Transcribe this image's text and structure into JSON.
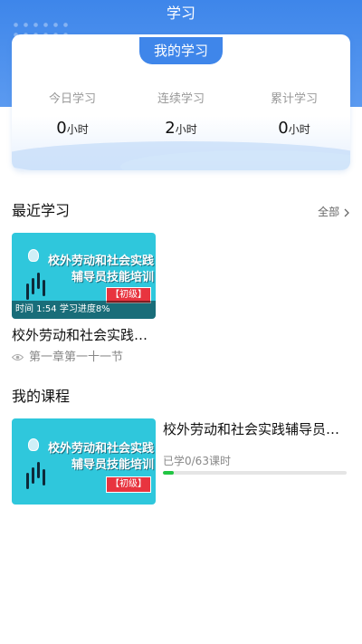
{
  "header": {
    "title": "学习"
  },
  "stats_card": {
    "tab_label": "我的学习",
    "stats": [
      {
        "label": "今日学习",
        "value": "0",
        "unit": "小时"
      },
      {
        "label": "连续学习",
        "value": "2",
        "unit": "小时"
      },
      {
        "label": "累计学习",
        "value": "0",
        "unit": "小时"
      }
    ]
  },
  "recent": {
    "section_title": "最近学习",
    "see_all": "全部",
    "item": {
      "thumb_line1": "校外劳动和社会实践",
      "thumb_line2": "辅导员技能培训",
      "level_tag": "【初级】",
      "overlay": "时间 1:54 学习进度8%",
      "title": "校外劳动和社会实践…",
      "chapter": "第一章第一十一节"
    }
  },
  "my_courses": {
    "section_title": "我的课程",
    "course": {
      "thumb_line1": "校外劳动和社会实践",
      "thumb_line2": "辅导员技能培训",
      "level_tag": "【初级】",
      "title": "校外劳动和社会实践辅导员…",
      "progress_text": "已学0/63课时",
      "progress": 0.06
    }
  },
  "colors": {
    "primary": "#3e86ea",
    "progress": "#21c542",
    "thumb_bg": "#2fc7dc",
    "tag": "#e8343f"
  },
  "icons": {
    "see_all": "chevron-right-icon",
    "views": "eye-icon"
  }
}
